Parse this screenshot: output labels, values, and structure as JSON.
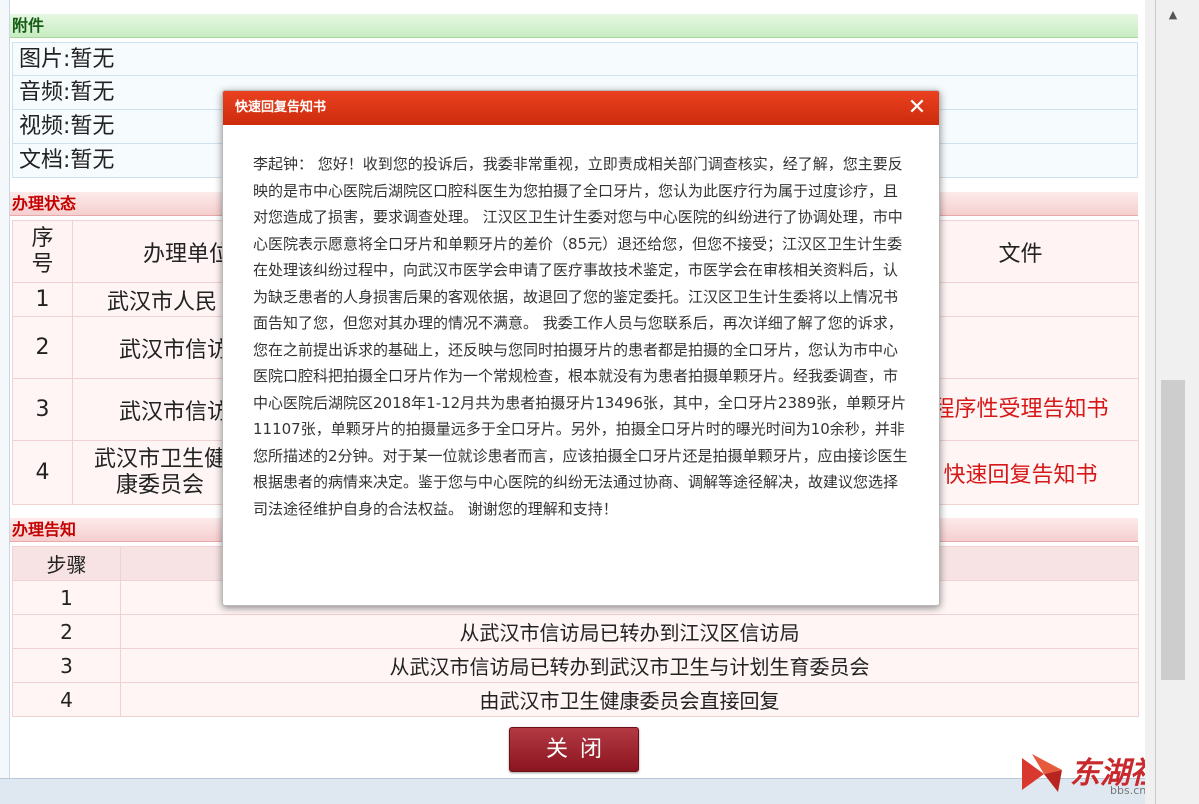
{
  "attachments": {
    "title": "附件",
    "rows": [
      {
        "label": "图片:暂无"
      },
      {
        "label": "音频:暂无"
      },
      {
        "label": "视频:暂无"
      },
      {
        "label": "文档:暂无"
      }
    ]
  },
  "status": {
    "title": "办理状态",
    "headers": {
      "seq": "序\n号",
      "unit": "办理单位",
      "file": "文件"
    },
    "rows": [
      {
        "seq": "1",
        "unit": "武汉市人民",
        "file": ""
      },
      {
        "seq": "2",
        "unit": "武汉市信访",
        "file": ""
      },
      {
        "seq": "3",
        "unit": "武汉市信访",
        "file": "程序性受理告知书"
      },
      {
        "seq": "4",
        "unit": "武汉市卫生健康委员会",
        "file": "快速回复告知书"
      }
    ]
  },
  "notice": {
    "title": "办理告知",
    "headers": {
      "step": "步骤",
      "content": ""
    },
    "rows": [
      {
        "step": "1",
        "content": ""
      },
      {
        "step": "2",
        "content": "从武汉市信访局已转办到江汉区信访局"
      },
      {
        "step": "3",
        "content": "从武汉市信访局已转办到武汉市卫生与计划生育委员会"
      },
      {
        "step": "4",
        "content": "由武汉市卫生健康委员会直接回复"
      }
    ]
  },
  "close_button": {
    "label": "关闭"
  },
  "watermark": {
    "text": "东湖社区",
    "url": "bbs.cnhubei.com"
  },
  "modal": {
    "title": "快速回复告知书",
    "close_symbol": "✕",
    "body": "李起钟： 您好！收到您的投诉后，我委非常重视，立即责成相关部门调查核实，经了解，您主要反映的是市中心医院后湖院区口腔科医生为您拍摄了全口牙片，您认为此医疗行为属于过度诊疗，且对您造成了损害，要求调查处理。 江汉区卫生计生委对您与中心医院的纠纷进行了协调处理，市中心医院表示愿意将全口牙片和单颗牙片的差价（85元）退还给您，但您不接受；江汉区卫生计生委在处理该纠纷过程中，向武汉市医学会申请了医疗事故技术鉴定，市医学会在审核相关资料后，认为缺乏患者的人身损害后果的客观依据，故退回了您的鉴定委托。江汉区卫生计生委将以上情况书面告知了您，但您对其办理的情况不满意。 我委工作人员与您联系后，再次详细了解了您的诉求，您在之前提出诉求的基础上，还反映与您同时拍摄牙片的患者都是拍摄的全口牙片，您认为市中心医院口腔科把拍摄全口牙片作为一个常规检查，根本就没有为患者拍摄单颗牙片。经我委调查，市中心医院后湖院区2018年1-12月共为患者拍摄牙片13496张，其中，全口牙片2389张，单颗牙片11107张，单颗牙片的拍摄量远多于全口牙片。另外，拍摄全口牙片时的曝光时间为10余秒，并非您所描述的2分钟。对于某一位就诊患者而言，应该拍摄全口牙片还是拍摄单颗牙片，应由接诊医生根据患者的病情来决定。鉴于您与中心医院的纠纷无法通过协商、调解等途径解决，故建议您选择司法途径维护自身的合法权益。 谢谢您的理解和支持！"
  }
}
